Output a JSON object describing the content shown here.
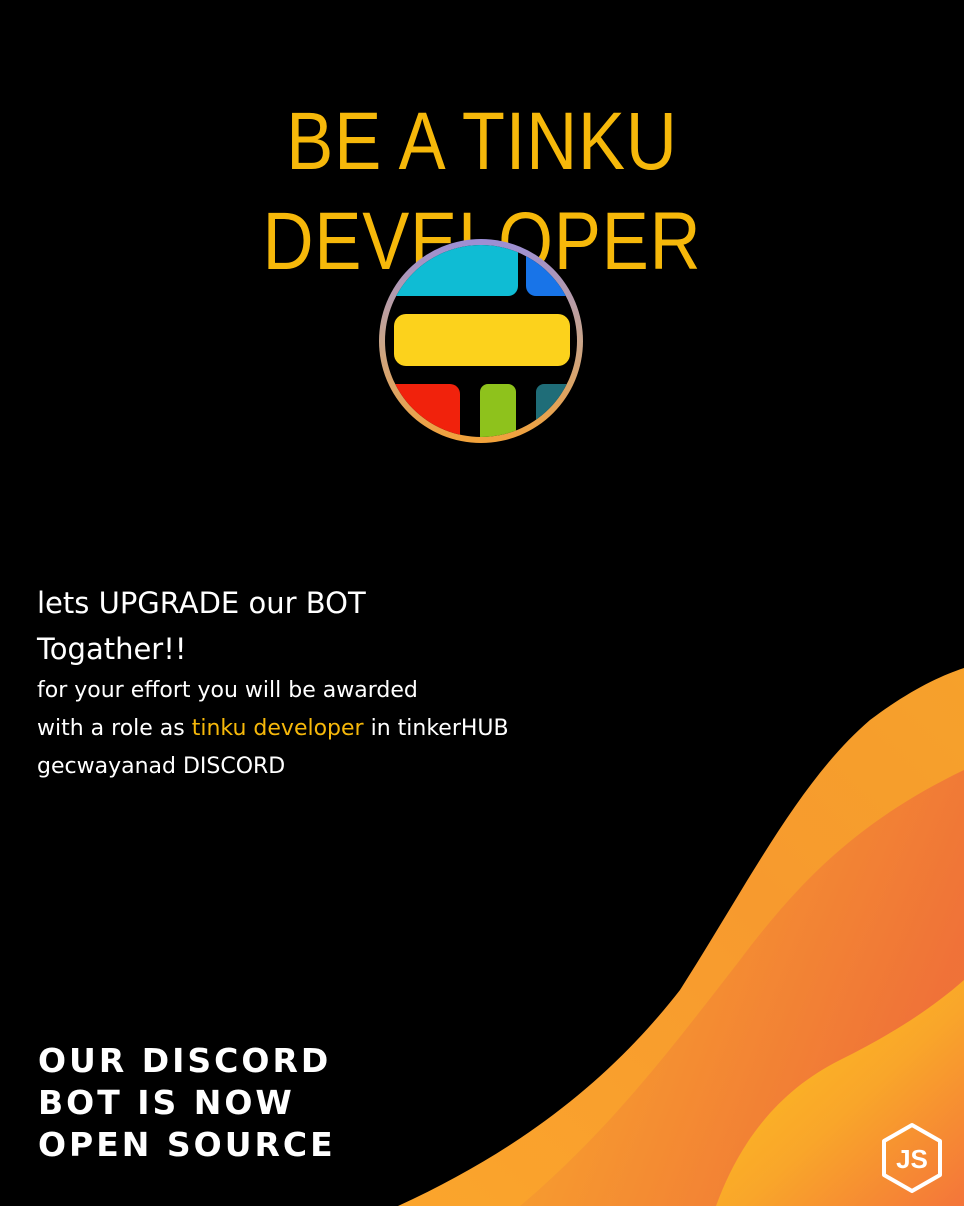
{
  "poster": {
    "headline": "BE A TINKU DEVELOPER",
    "pitch": {
      "line1": "lets UPGRADE our BOT",
      "line2": "Togather!!",
      "body_line1": "for your effort you will be awarded",
      "body_line2_before": "with a role as ",
      "body_line2_highlight": "tinku developer",
      "body_line2_after": " in tinkerHUB",
      "body_line3": "gecwayanad DISCORD"
    },
    "announce": {
      "line1": "OUR DISCORD",
      "line2": "BOT IS NOW",
      "line3": "OPEN SOURCE"
    },
    "icons": {
      "logo": "tinkerhub-logo-icon",
      "nodejs": "nodejs-icon"
    },
    "nodejs_logo_text": "JS",
    "colors": {
      "background": "#000000",
      "headline": "#F6B80A",
      "highlight": "#F6B80A",
      "text": "#FFFFFF",
      "wave_light": "#FFC21F",
      "wave_dark": "#F0703A"
    }
  }
}
